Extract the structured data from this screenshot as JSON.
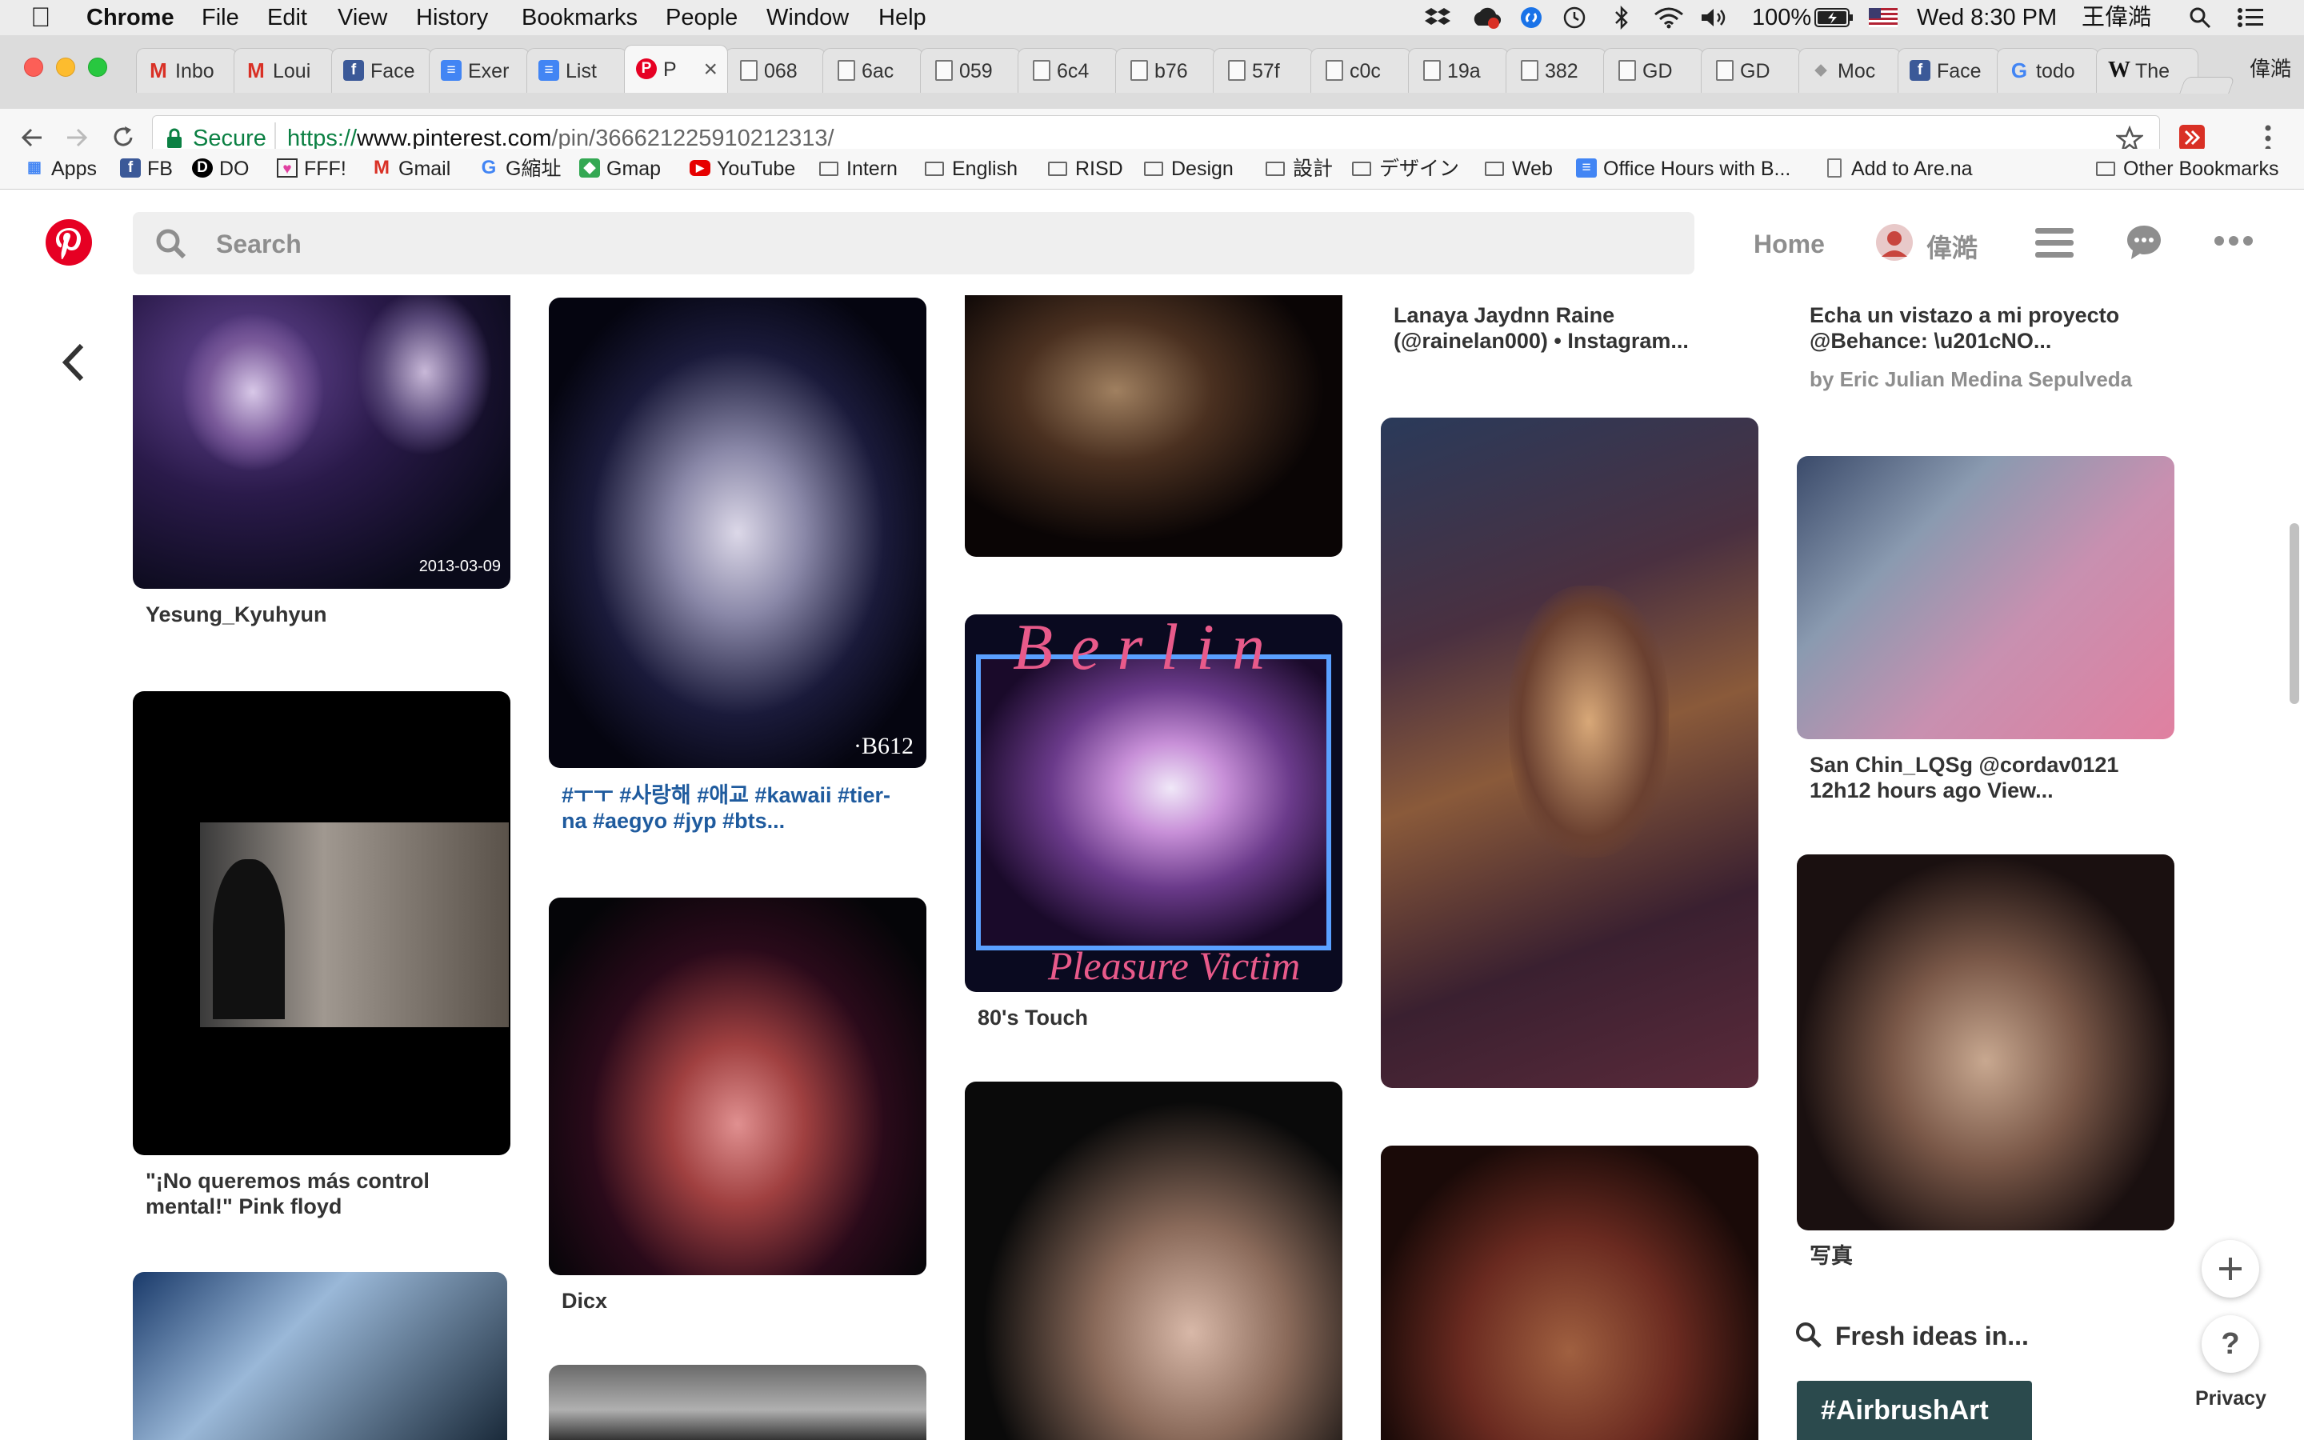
{
  "menubar": {
    "app": "Chrome",
    "menus": [
      "File",
      "Edit",
      "View",
      "History",
      "Bookmarks",
      "People",
      "Window",
      "Help"
    ],
    "battery": "100%",
    "datetime": "Wed 8:30 PM",
    "user": "王偉澔"
  },
  "tabs": [
    {
      "title": "Inbo",
      "icon": "gmail-icon"
    },
    {
      "title": "Loui",
      "icon": "gmail-icon"
    },
    {
      "title": "Face",
      "icon": "facebook-icon"
    },
    {
      "title": "Exer",
      "icon": "docs-icon"
    },
    {
      "title": "List",
      "icon": "docs-icon"
    },
    {
      "title": "P",
      "icon": "pinterest-icon",
      "active": true
    },
    {
      "title": "068",
      "icon": "page-icon"
    },
    {
      "title": "6ac",
      "icon": "page-icon"
    },
    {
      "title": "059",
      "icon": "page-icon"
    },
    {
      "title": "6c4",
      "icon": "page-icon"
    },
    {
      "title": "b76",
      "icon": "page-icon"
    },
    {
      "title": "57f",
      "icon": "page-icon"
    },
    {
      "title": "c0c",
      "icon": "page-icon"
    },
    {
      "title": "19a",
      "icon": "page-icon"
    },
    {
      "title": "382",
      "icon": "page-icon"
    },
    {
      "title": "GD",
      "icon": "page-icon"
    },
    {
      "title": "GD",
      "icon": "page-icon"
    },
    {
      "title": "Moc",
      "icon": "moc-icon"
    },
    {
      "title": "Face",
      "icon": "facebook-icon"
    },
    {
      "title": "todo",
      "icon": "google-icon"
    },
    {
      "title": "The",
      "icon": "wikipedia-icon"
    }
  ],
  "profile_name": "偉澔",
  "address": {
    "secure_label": "Secure",
    "scheme": "https://",
    "host": "www.pinterest.com",
    "path": "/pin/366621225910212313/"
  },
  "bookmarks": [
    {
      "label": "Apps",
      "icon": "apps-icon"
    },
    {
      "label": "FB",
      "icon": "facebook-icon"
    },
    {
      "label": "DO",
      "icon": "do-icon"
    },
    {
      "label": "FFF!",
      "icon": "heart-icon"
    },
    {
      "label": "Gmail",
      "icon": "gmail-icon"
    },
    {
      "label": "G縮址",
      "icon": "google-icon"
    },
    {
      "label": "Gmap",
      "icon": "maps-icon"
    },
    {
      "label": "YouTube",
      "icon": "youtube-icon"
    },
    {
      "label": "Intern",
      "icon": "folder-icon"
    },
    {
      "label": "English",
      "icon": "folder-icon"
    },
    {
      "label": "RISD",
      "icon": "folder-icon"
    },
    {
      "label": "Design",
      "icon": "folder-icon"
    },
    {
      "label": "設計",
      "icon": "folder-icon"
    },
    {
      "label": "デザイン",
      "icon": "folder-icon"
    },
    {
      "label": "Web",
      "icon": "folder-icon"
    },
    {
      "label": "Office Hours with B...",
      "icon": "docs-icon"
    },
    {
      "label": "Add to Are.na",
      "icon": "page-icon"
    }
  ],
  "other_bookmarks": "Other Bookmarks",
  "pinterest": {
    "search_placeholder": "Search",
    "home": "Home",
    "username": "偉澔"
  },
  "pins": {
    "p1_date": "2013-03-09",
    "p1_caption": "Yesung_Kyuhyun",
    "p2_caption": "\"¡No queremos más control\nmental!\" Pink floyd",
    "p3_watermark": "·B612",
    "p3_caption": "#ㅜㅜ #사랑해 #애교 #kawaii #tier-\nna #aegyo #jyp #bts...",
    "p4_caption": "Dicx",
    "p5_title_text": "Berlin",
    "p5_subtitle_text": "Pleasure Victim",
    "p5_caption": "80's Touch",
    "p6_caption": "Lanaya Jaydnn Raine\n(@rainelan000) • Instagram...",
    "p7_caption": "Echa un vistazo a mi proyecto\n@Behance: \\u201cNO...",
    "p7_by": "by Eric Julian Medina Sepulveda",
    "p8_caption": "San Chin_LQSg @cordav0121\n12h12 hours ago View...",
    "p9_caption": "写真"
  },
  "fresh_ideas": "Fresh ideas in...",
  "tag_button": "#AirbrushArt",
  "privacy": "Privacy",
  "colors": {
    "pinterest_red": "#e60023",
    "secure_green": "#0b8043",
    "link_blue": "#1f5b9e"
  }
}
